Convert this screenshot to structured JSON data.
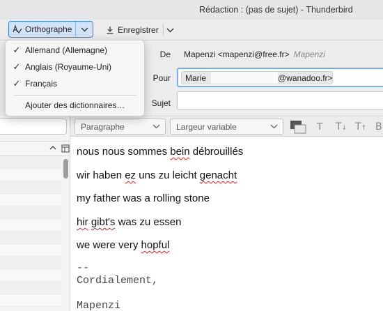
{
  "window": {
    "title": "Rédaction : (pas de sujet) - Thunderbird"
  },
  "toolbar": {
    "spelling_label": "Orthographe",
    "save_label": "Enregistrer"
  },
  "spell_menu": {
    "languages": [
      {
        "label": "Allemand (Allemagne)",
        "checked": true
      },
      {
        "label": "Anglais (Royaume-Uni)",
        "checked": true
      },
      {
        "label": "Français",
        "checked": true
      }
    ],
    "add_dictionaries": "Ajouter des dictionnaires…"
  },
  "headers": {
    "from_label": "De",
    "from_value": "Mapenzi <mapenzi@free.fr>",
    "from_identity": "Mapenzi",
    "to_label": "Pour",
    "recipient_name": "Marie",
    "recipient_domain": "@wanadoo.fr>",
    "subject_label": "Sujet",
    "subject_value": ""
  },
  "format": {
    "paragraph_style": "Paragraphe",
    "font": "Largeur variable"
  },
  "body": {
    "line1_a": "nous nous sommes ",
    "line1_b": "bein",
    "line1_c": " débrouillés",
    "line2_a": "wir haben ",
    "line2_b": "ez",
    "line2_c": " uns zu leicht ",
    "line2_d": "genacht",
    "line3": "my father was a rolling stone",
    "line4_a": "hir",
    "line4_b": " ",
    "line4_c": "gibt's",
    "line4_d": " was zu essen",
    "line5_a": "we were very ",
    "line5_b": "hopful",
    "sig_sep": "--",
    "sig_greeting": "Cordialement,",
    "sig_name": "Mapenzi"
  },
  "colors": {
    "accent": "#2b7de9",
    "misspelling": "#dd2222"
  }
}
